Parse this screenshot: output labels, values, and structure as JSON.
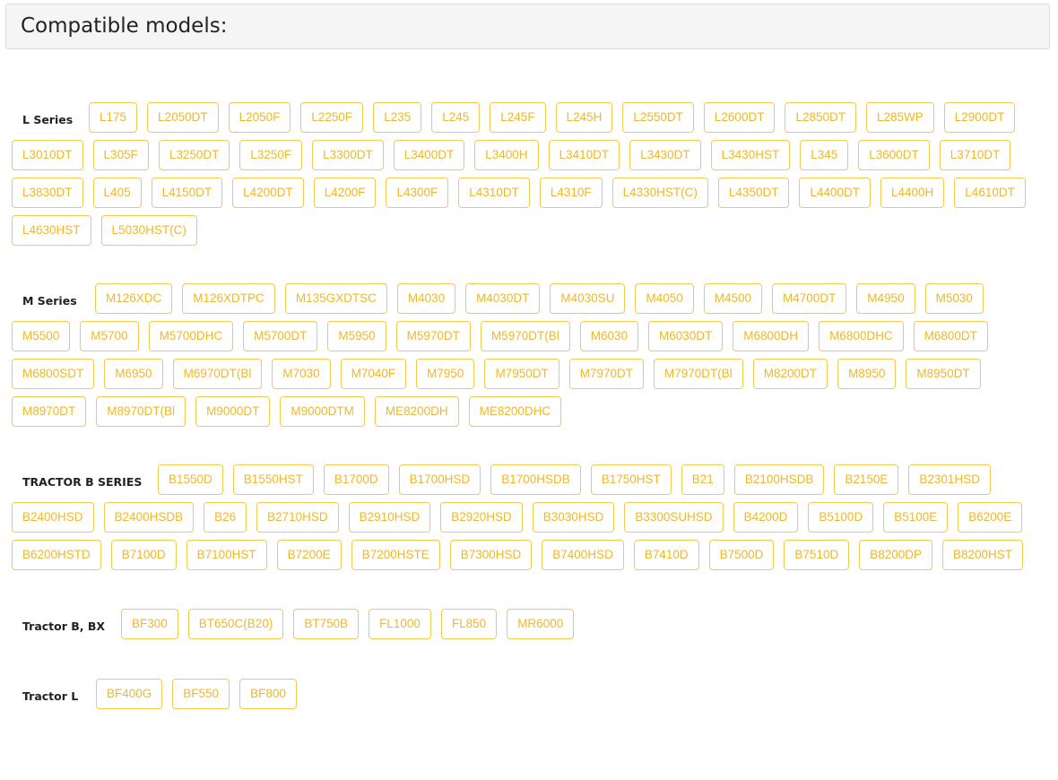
{
  "page_title": "Compatible models:",
  "series": [
    {
      "label": "L Series",
      "models": [
        "L175",
        "L2050DT",
        "L2050F",
        "L2250F",
        "L235",
        "L245",
        "L245F",
        "L245H",
        "L2550DT",
        "L2600DT",
        "L2850DT",
        "L285WP",
        "L2900DT",
        "L3010DT",
        "L305F",
        "L3250DT",
        "L3250F",
        "L3300DT",
        "L3400DT",
        "L3400H",
        "L3410DT",
        "L3430DT",
        "L3430HST",
        "L345",
        "L3600DT",
        "L3710DT",
        "L3830DT",
        "L405",
        "L4150DT",
        "L4200DT",
        "L4200F",
        "L4300F",
        "L4310DT",
        "L4310F",
        "L4330HST(C)",
        "L4350DT",
        "L4400DT",
        "L4400H",
        "L4610DT",
        "L4630HST",
        "L5030HST(C)"
      ]
    },
    {
      "label": "M Series",
      "models": [
        "M126XDC",
        "M126XDTPC",
        "M135GXDTSC",
        "M4030",
        "M4030DT",
        "M4030SU",
        "M4050",
        "M4500",
        "M4700DT",
        "M4950",
        "M5030",
        "M5500",
        "M5700",
        "M5700DHC",
        "M5700DT",
        "M5950",
        "M5970DT",
        "M5970DT(Bl",
        "M6030",
        "M6030DT",
        "M6800DH",
        "M6800DHC",
        "M6800DT",
        "M6800SDT",
        "M6950",
        "M6970DT(Bl",
        "M7030",
        "M7040F",
        "M7950",
        "M7950DT",
        "M7970DT",
        "M7970DT(Bl",
        "M8200DT",
        "M8950",
        "M8950DT",
        "M8970DT",
        "M8970DT(Bl",
        "M9000DT",
        "M9000DTM",
        "ME8200DH",
        "ME8200DHC"
      ]
    },
    {
      "label": "TRACTOR B SERIES",
      "models": [
        "B1550D",
        "B1550HST",
        "B1700D",
        "B1700HSD",
        "B1700HSDB",
        "B1750HST",
        "B21",
        "B2100HSDB",
        "B2150E",
        "B2301HSD",
        "B2400HSD",
        "B2400HSDB",
        "B26",
        "B2710HSD",
        "B2910HSD",
        "B2920HSD",
        "B3030HSD",
        "B3300SUHSD",
        "B4200D",
        "B5100D",
        "B5100E",
        "B6200E",
        "B6200HSTD",
        "B7100D",
        "B7100HST",
        "B7200E",
        "B7200HSTE",
        "B7300HSD",
        "B7400HSD",
        "B7410D",
        "B7500D",
        "B7510D",
        "B8200DP",
        "B8200HST"
      ]
    },
    {
      "label": "Tractor B, BX",
      "models": [
        "BF300",
        "BT650C(B20)",
        "BT750B",
        "FL1000",
        "FL850",
        "MR6000"
      ]
    },
    {
      "label": "Tractor L",
      "models": [
        "BF400G",
        "BF550",
        "BF800"
      ]
    }
  ]
}
